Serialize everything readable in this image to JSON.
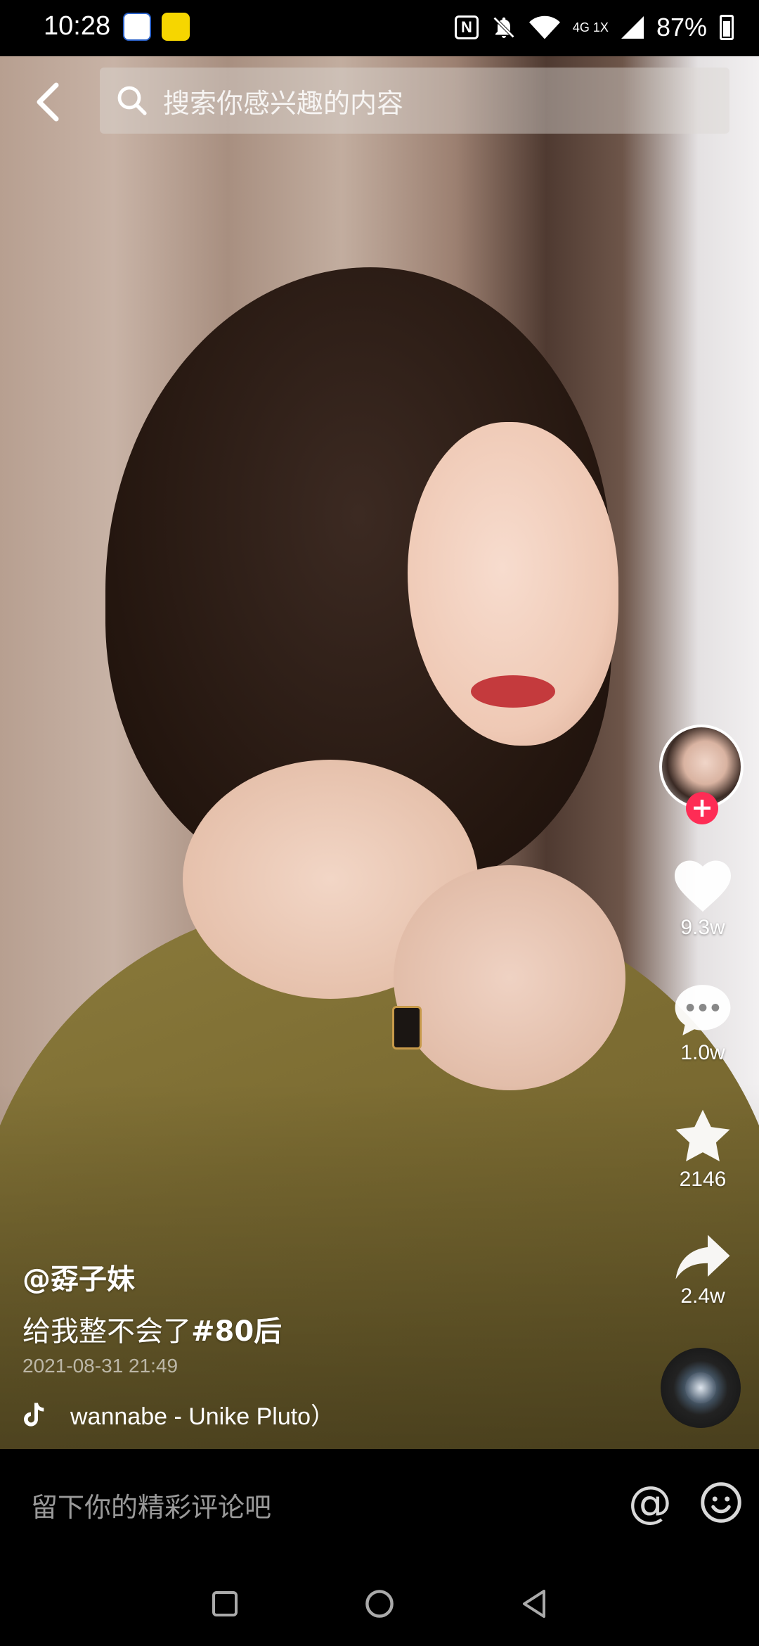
{
  "status_bar": {
    "time": "10:28",
    "network": "4G 1X",
    "battery": "87%",
    "icons": [
      "app-notification-icon",
      "app-notification-icon",
      "nfc-icon",
      "bell-off-icon",
      "wifi-icon",
      "signal-icon",
      "battery-icon"
    ]
  },
  "header": {
    "search_placeholder": "搜索你感兴趣的内容"
  },
  "actions": {
    "like_count": "9.3w",
    "comment_count": "1.0w",
    "favorite_count": "2146",
    "share_count": "2.4w",
    "follow_symbol": "+"
  },
  "post": {
    "author": "@孬子妹",
    "caption_text": "给我整不会了",
    "caption_tag": "#80后",
    "date": "2021-08-31 21:49",
    "music": "wannabe - Unike Pluto）"
  },
  "comment": {
    "placeholder": "留下你的精彩评论吧",
    "at_symbol": "@"
  },
  "colors": {
    "accent": "#fe2c55",
    "background": "#000000"
  }
}
